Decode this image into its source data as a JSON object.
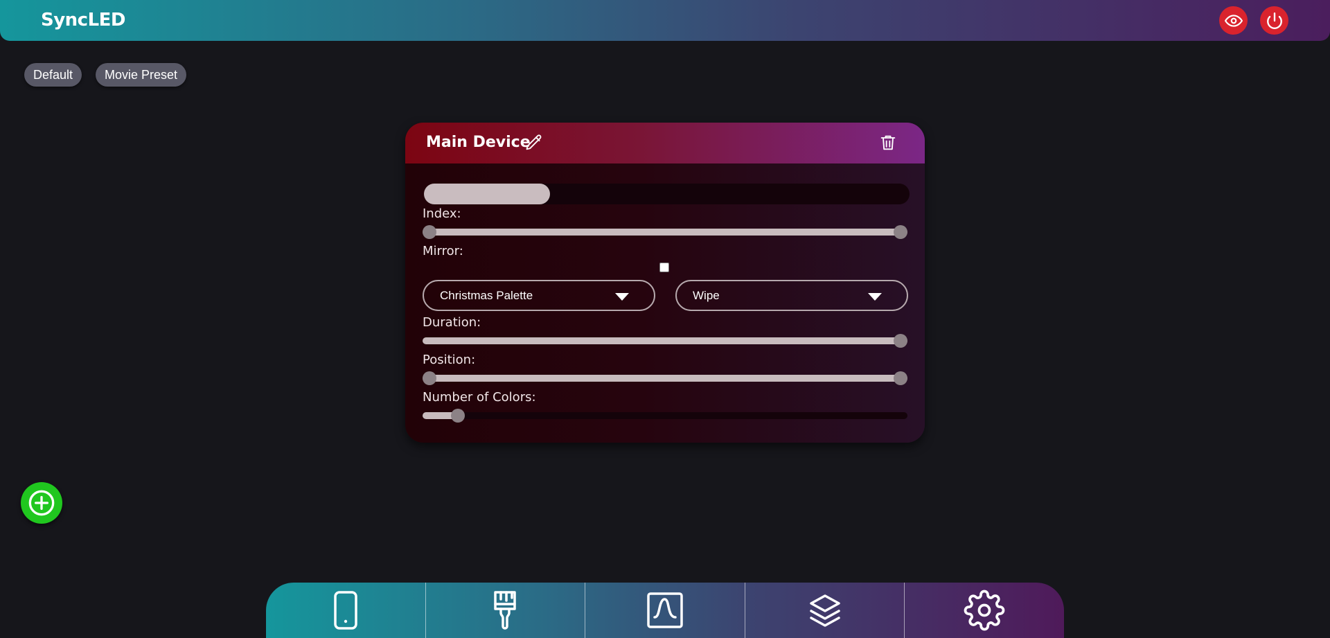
{
  "header": {
    "app_title": "SyncLED",
    "view_icon": "eye-icon",
    "power_icon": "power-icon",
    "accent_color": "#d9232d"
  },
  "presets": [
    {
      "label": "Default"
    },
    {
      "label": "Movie Preset"
    }
  ],
  "device_card": {
    "title": "Main Device",
    "edit_icon": "pencil-icon",
    "delete_icon": "trash-icon",
    "progress": 0.26,
    "controls": {
      "index": {
        "label": "Index:",
        "low": 0,
        "high": 1
      },
      "mirror": {
        "label": "Mirror:",
        "checked": false
      },
      "palette": {
        "value": "Christmas Palette"
      },
      "effect": {
        "value": "Wipe"
      },
      "duration": {
        "label": "Duration:",
        "value": 1
      },
      "position": {
        "label": "Position:",
        "low": 0,
        "high": 1
      },
      "number_of_colors": {
        "label": "Number of Colors:",
        "value": 0.06
      }
    }
  },
  "add_button": {
    "icon": "plus-circle-icon",
    "color": "#20c71f"
  },
  "bottom_nav": [
    {
      "name": "devices",
      "icon": "phone-icon"
    },
    {
      "name": "effects",
      "icon": "paintbrush-icon"
    },
    {
      "name": "curves",
      "icon": "curve-icon"
    },
    {
      "name": "layers",
      "icon": "layers-icon"
    },
    {
      "name": "settings",
      "icon": "gear-icon"
    }
  ]
}
